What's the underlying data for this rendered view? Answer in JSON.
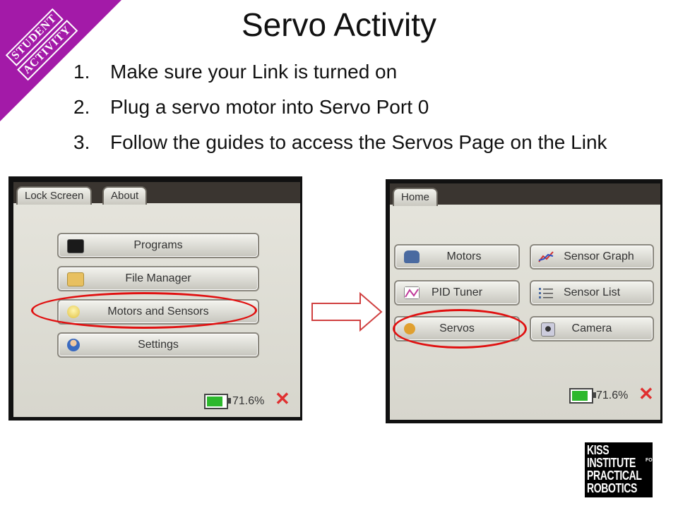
{
  "corner_badge": {
    "line1": "STUDENT",
    "line2": "ACTIVITY",
    "color": "#a31aa8"
  },
  "title": "Servo Activity",
  "steps": [
    {
      "num": "1.",
      "text": "Make sure your Link is turned on"
    },
    {
      "num": "2.",
      "text": "Plug a servo motor into Servo Port 0"
    },
    {
      "num": "3.",
      "text": "Follow the guides to access the Servos Page on the Link"
    }
  ],
  "screen1": {
    "tabs": [
      "Lock Screen",
      "About"
    ],
    "buttons": [
      {
        "label": "Programs",
        "icon": "terminal-icon"
      },
      {
        "label": "File Manager",
        "icon": "folder-icon"
      },
      {
        "label": "Motors and Sensors",
        "icon": "lightbulb-icon",
        "highlighted": true
      },
      {
        "label": "Settings",
        "icon": "user-icon"
      }
    ],
    "battery": "71.6%"
  },
  "screen2": {
    "tabs": [
      "Home"
    ],
    "buttons": [
      {
        "label": "Motors",
        "icon": "car-icon"
      },
      {
        "label": "Sensor Graph",
        "icon": "graph-icon"
      },
      {
        "label": "PID Tuner",
        "icon": "pid-chart-icon"
      },
      {
        "label": "Sensor List",
        "icon": "list-icon"
      },
      {
        "label": "Servos",
        "icon": "servo-icon",
        "highlighted": true
      },
      {
        "label": "Camera",
        "icon": "camera-icon"
      }
    ],
    "battery": "71.6%"
  },
  "logo": {
    "lines": [
      "KISS",
      "INSTITUTE",
      "PRACTICAL",
      "ROBOTICS"
    ],
    "for": "FOR"
  },
  "colors": {
    "highlight_ring": "#e01010",
    "battery_fill": "#2db82d",
    "close_x": "#e03030"
  }
}
